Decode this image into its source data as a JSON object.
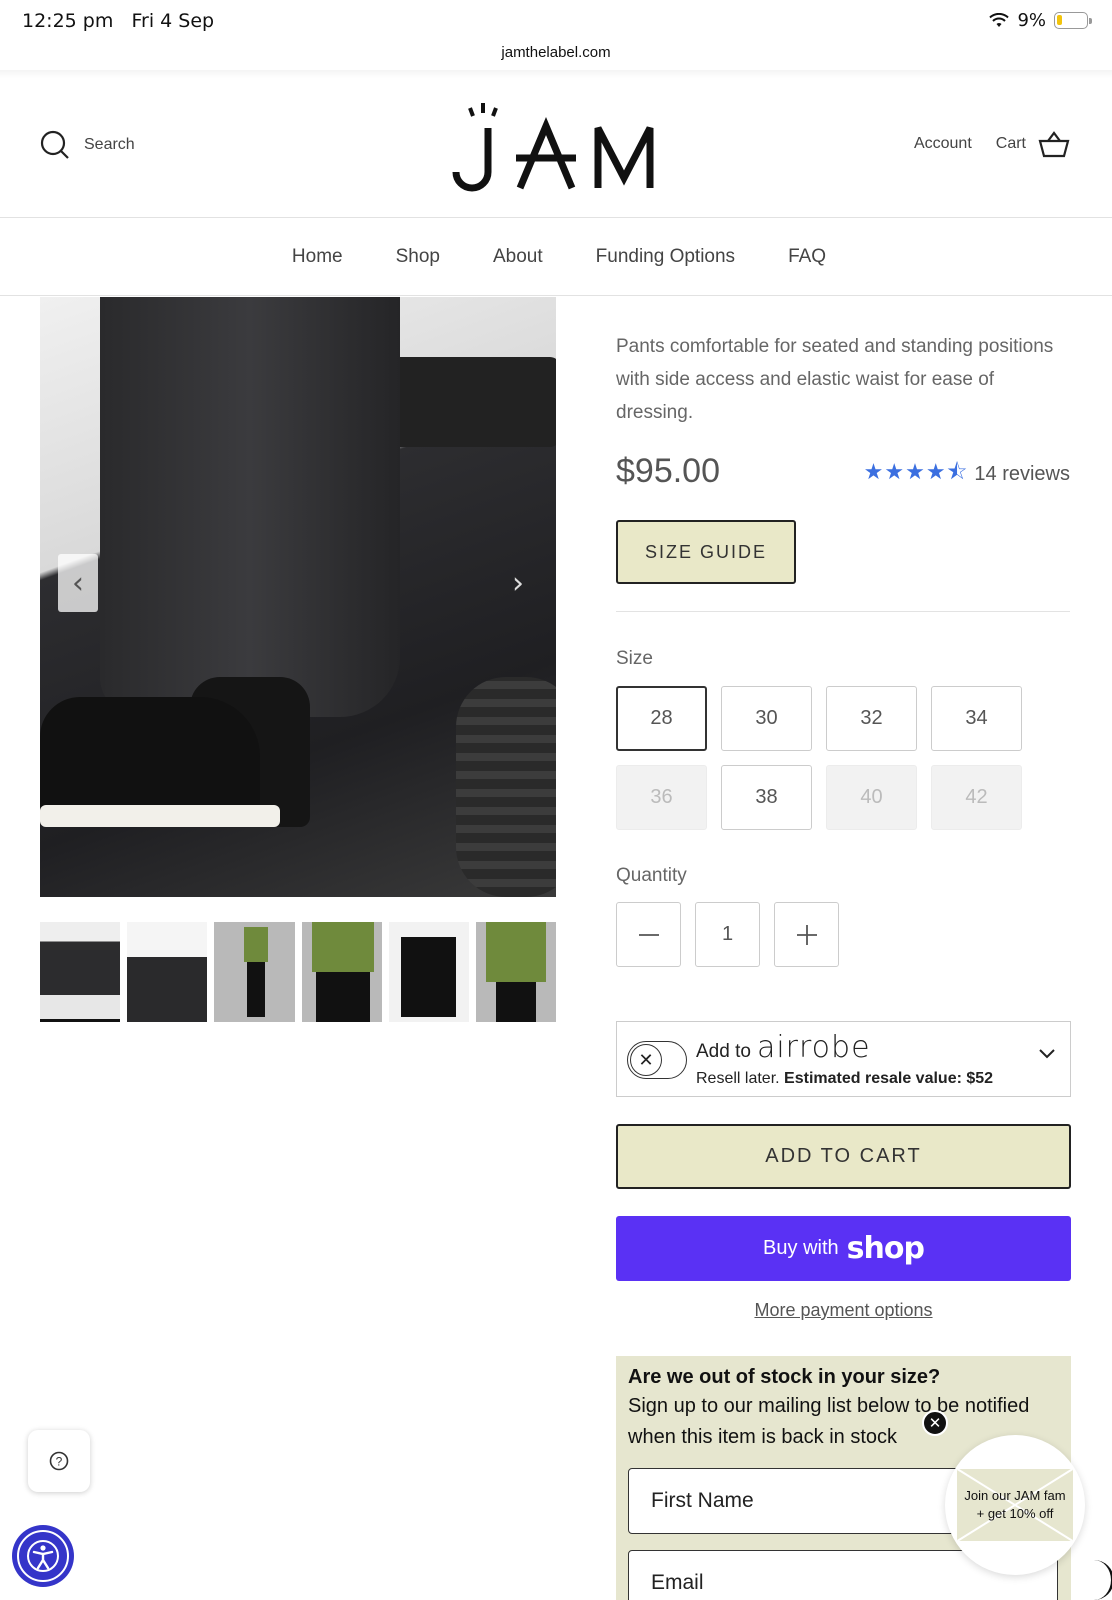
{
  "status_bar": {
    "time": "12:25 pm",
    "date": "Fri 4 Sep",
    "battery": "9%"
  },
  "browser": {
    "url": "jamthelabel.com"
  },
  "header": {
    "search_label": "Search",
    "logo": "JAM",
    "account_label": "Account",
    "cart_label": "Cart"
  },
  "nav": {
    "items": [
      "Home",
      "Shop",
      "About",
      "Funding Options",
      "FAQ"
    ]
  },
  "gallery": {
    "prev_arrow": "‹",
    "next_arrow": "›",
    "thumbnail_count": 6,
    "selected_thumbnail": 0
  },
  "product": {
    "description": "Pants comfortable for seated and standing positions with side access and elastic waist for ease of dressing.",
    "price": "$95.00",
    "rating": 4.5,
    "stars": "★★★★⯪",
    "reviews_label": "14 reviews",
    "size_guide_label": "SIZE GUIDE",
    "size_label": "Size",
    "sizes": [
      {
        "label": "28",
        "state": "selected"
      },
      {
        "label": "30",
        "state": "available"
      },
      {
        "label": "32",
        "state": "available"
      },
      {
        "label": "34",
        "state": "available"
      },
      {
        "label": "36",
        "state": "unavailable"
      },
      {
        "label": "38",
        "state": "available"
      },
      {
        "label": "40",
        "state": "unavailable"
      },
      {
        "label": "42",
        "state": "unavailable"
      }
    ],
    "quantity_label": "Quantity",
    "quantity": "1",
    "minus": "−",
    "plus": "+"
  },
  "airrobe": {
    "add_to": "Add to",
    "brand": "airrobe",
    "resell_text": "Resell later.",
    "estimate_text": "Estimated resale value: $52",
    "toggle_icon": "✕",
    "chevron": "⌄"
  },
  "actions": {
    "add_to_cart": "ADD TO CART",
    "buy_with": "Buy with",
    "shop_brand": "shop",
    "more_payment": "More payment options"
  },
  "out_of_stock": {
    "title": "Are we out of stock in your size?",
    "body": "Sign up to our mailing list below to be notified when this item is back in stock",
    "first_name_placeholder": "First Name",
    "email_placeholder": "Email"
  },
  "popup": {
    "text_line1": "Join our JAM fam",
    "text_line2": "+ get 10% off",
    "close": "✕"
  },
  "help_icon": "?",
  "colors": {
    "accent_button": "#e9e8c8",
    "shop_pay": "#5a31f4",
    "star": "#3b6fe0",
    "accessibility": "#3535c9"
  }
}
